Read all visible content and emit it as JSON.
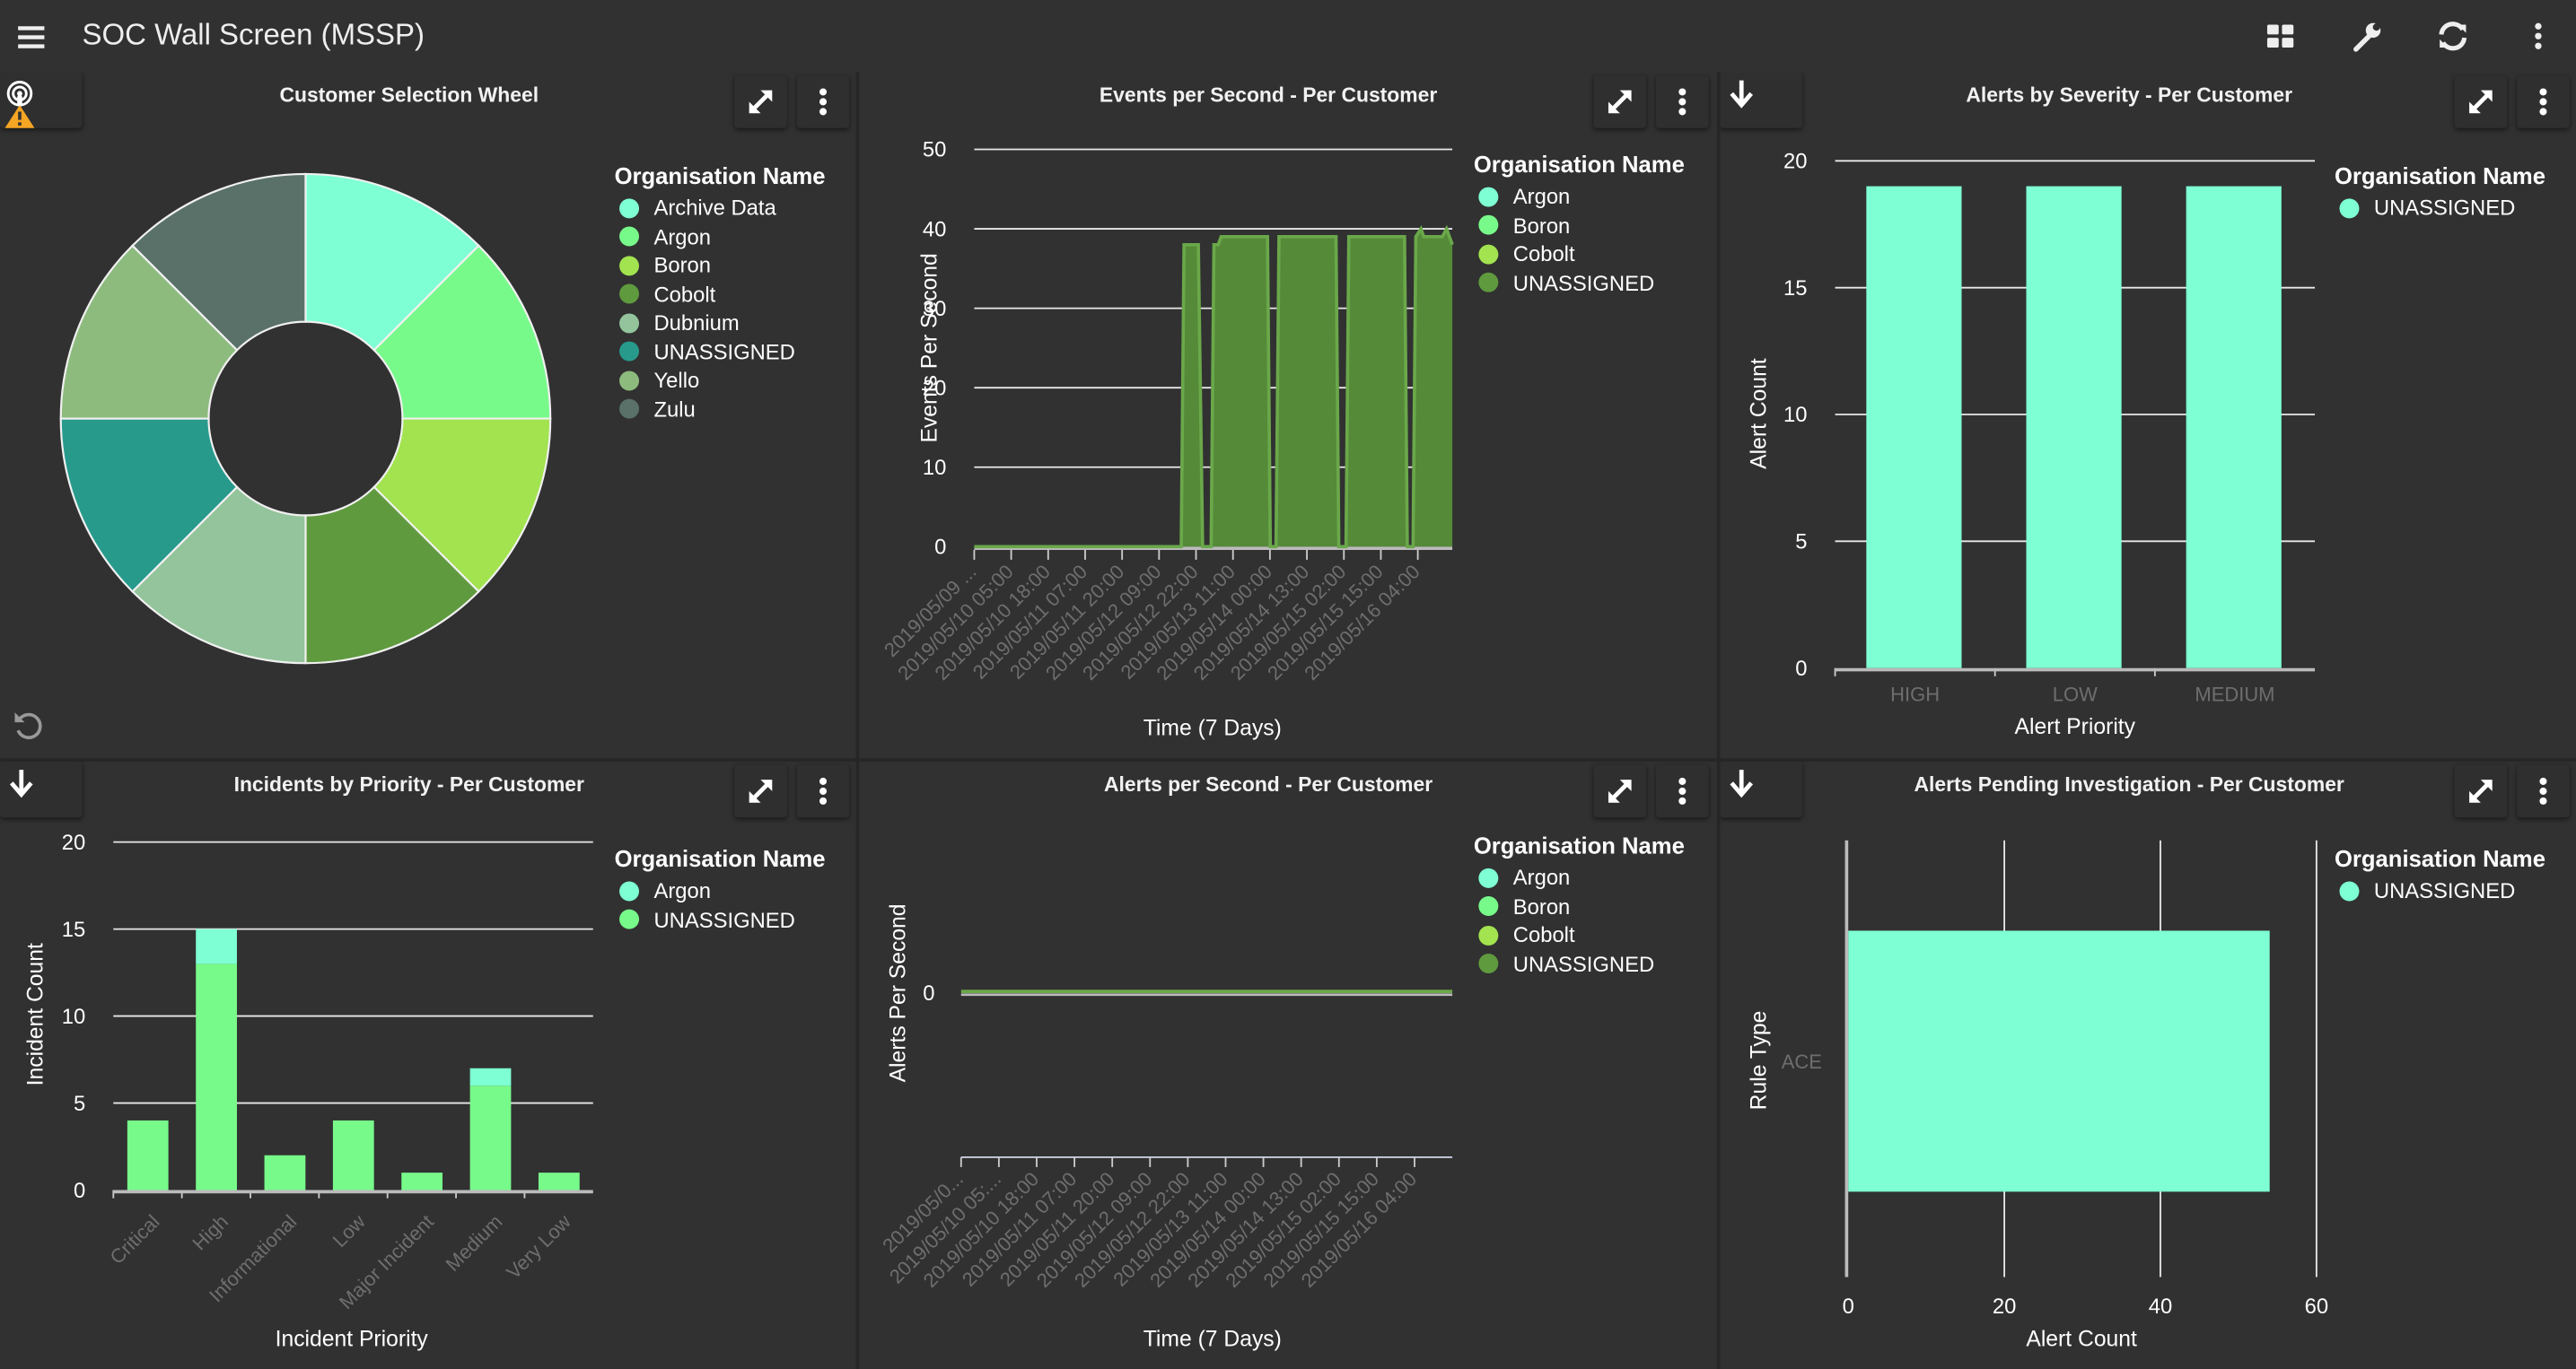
{
  "header": {
    "title": "SOC Wall Screen (MSSP)",
    "icons": [
      "menu-icon",
      "dashboard-grid-icon",
      "wrench-icon",
      "refresh-icon",
      "more-vertical-icon"
    ]
  },
  "colors": {
    "background": "#313131",
    "aquamarine": "#7effd4",
    "green": "#78fa8a",
    "lime": "#a2e34f",
    "darkgreen": "#5f9a3e",
    "warning": "#f5a623"
  },
  "panels": [
    {
      "title": "Customer Selection Wheel",
      "legend": {
        "title": "Organisation Name",
        "items": [
          {
            "label": "Archive Data",
            "color": "#7effd4"
          },
          {
            "label": "Argon",
            "color": "#78fa8a"
          },
          {
            "label": "Boron",
            "color": "#a2e34f"
          },
          {
            "label": "Cobolt",
            "color": "#5f9a3e"
          },
          {
            "label": "Dubnium",
            "color": "#93c49b"
          },
          {
            "label": "UNASSIGNED",
            "color": "#279a8c"
          },
          {
            "label": "Yello",
            "color": "#8dbb7e"
          },
          {
            "label": "Zulu",
            "color": "#5a716a"
          }
        ]
      }
    },
    {
      "title": "Events per Second - Per Customer",
      "legend": {
        "title": "Organisation Name",
        "items": [
          {
            "label": "Argon",
            "color": "#7effd4"
          },
          {
            "label": "Boron",
            "color": "#78fa8a"
          },
          {
            "label": "Cobolt",
            "color": "#a2e34f"
          },
          {
            "label": "UNASSIGNED",
            "color": "#5f9a3e"
          }
        ]
      }
    },
    {
      "title": "Alerts by Severity - Per Customer",
      "legend": {
        "title": "Organisation Name",
        "items": [
          {
            "label": "UNASSIGNED",
            "color": "#7effd4"
          }
        ]
      }
    },
    {
      "title": "Incidents by Priority - Per Customer",
      "legend": {
        "title": "Organisation Name",
        "items": [
          {
            "label": "Argon",
            "color": "#7effd4"
          },
          {
            "label": "UNASSIGNED",
            "color": "#78fa8a"
          }
        ]
      }
    },
    {
      "title": "Alerts per Second - Per Customer",
      "legend": {
        "title": "Organisation Name",
        "items": [
          {
            "label": "Argon",
            "color": "#7effd4"
          },
          {
            "label": "Boron",
            "color": "#78fa8a"
          },
          {
            "label": "Cobolt",
            "color": "#a2e34f"
          },
          {
            "label": "UNASSIGNED",
            "color": "#5f9a3e"
          }
        ]
      }
    },
    {
      "title": "Alerts Pending Investigation - Per Customer",
      "legend": {
        "title": "Organisation Name",
        "items": [
          {
            "label": "UNASSIGNED",
            "color": "#7effd4"
          }
        ]
      }
    }
  ],
  "chart_data": [
    {
      "type": "pie",
      "donut": true,
      "categories": [
        "Archive Data",
        "Argon",
        "Boron",
        "Cobolt",
        "Dubnium",
        "UNASSIGNED",
        "Yello",
        "Zulu"
      ],
      "values": [
        1,
        1,
        1,
        1,
        1,
        1,
        1,
        1
      ]
    },
    {
      "type": "area",
      "xlabel": "Time (7 Days)",
      "ylabel": "Events Per Second",
      "ylim": [
        0,
        50
      ],
      "yticks": [
        0,
        10,
        20,
        30,
        40,
        50
      ],
      "xtick_labels": [
        "2019/05/09 ...",
        "2019/05/10 05:00",
        "2019/05/10 18:00",
        "2019/05/11 07:00",
        "2019/05/11 20:00",
        "2019/05/12 09:00",
        "2019/05/12 22:00",
        "2019/05/13 11:00",
        "2019/05/14 00:00",
        "2019/05/14 13:00",
        "2019/05/15 02:00",
        "2019/05/15 15:00",
        "2019/05/16 04:00"
      ],
      "xlim": [
        "2019-05-09 16:00",
        "2019-05-16 15:30"
      ],
      "grid": true,
      "series": [
        {
          "name": "UNASSIGNED",
          "color": "#5f9a3e",
          "points": [
            [
              "2019-05-09 16:00",
              0
            ],
            [
              "2019-05-12 16:30",
              0
            ],
            [
              "2019-05-12 17:30",
              38
            ],
            [
              "2019-05-12 22:30",
              38
            ],
            [
              "2019-05-13 00:00",
              0
            ],
            [
              "2019-05-13 03:00",
              0
            ],
            [
              "2019-05-13 04:00",
              38
            ],
            [
              "2019-05-13 05:30",
              38
            ],
            [
              "2019-05-13 06:30",
              39
            ],
            [
              "2019-05-13 22:45",
              39
            ],
            [
              "2019-05-13 23:45",
              0
            ],
            [
              "2019-05-14 01:45",
              0
            ],
            [
              "2019-05-14 02:45",
              39
            ],
            [
              "2019-05-14 22:45",
              39
            ],
            [
              "2019-05-14 23:45",
              0
            ],
            [
              "2019-05-15 02:15",
              0
            ],
            [
              "2019-05-15 03:15",
              39
            ],
            [
              "2019-05-15 22:45",
              39
            ],
            [
              "2019-05-15 23:45",
              0
            ],
            [
              "2019-05-16 01:45",
              0
            ],
            [
              "2019-05-16 02:45",
              39
            ],
            [
              "2019-05-16 04:30",
              40
            ],
            [
              "2019-05-16 05:30",
              39
            ],
            [
              "2019-05-16 12:00",
              39
            ],
            [
              "2019-05-16 13:30",
              40
            ],
            [
              "2019-05-16 15:30",
              38
            ]
          ]
        }
      ]
    },
    {
      "type": "bar",
      "xlabel": "Alert Priority",
      "ylabel": "Alert Count",
      "ylim": [
        0,
        20
      ],
      "yticks": [
        0,
        5,
        10,
        15,
        20
      ],
      "grid": true,
      "categories": [
        "HIGH",
        "LOW",
        "MEDIUM"
      ],
      "series": [
        {
          "name": "UNASSIGNED",
          "color": "#7effd4",
          "values": [
            19,
            19,
            19
          ]
        }
      ]
    },
    {
      "type": "bar",
      "stacked": true,
      "xlabel": "Incident Priority",
      "ylabel": "Incident Count",
      "ylim": [
        0,
        20
      ],
      "yticks": [
        0,
        5,
        10,
        15,
        20
      ],
      "grid": true,
      "categories": [
        "Critical",
        "High",
        "Informational",
        "Low",
        "Major Incident",
        "Medium",
        "Very Low"
      ],
      "series": [
        {
          "name": "UNASSIGNED",
          "color": "#78fa8a",
          "values": [
            4,
            13,
            2,
            4,
            1,
            6,
            1
          ]
        },
        {
          "name": "Argon",
          "color": "#7effd4",
          "values": [
            0,
            2,
            0,
            0,
            0,
            1,
            0
          ]
        }
      ]
    },
    {
      "type": "line",
      "xlabel": "Time (7 Days)",
      "ylabel": "Alerts Per Second",
      "yticks": [
        0
      ],
      "xtick_labels": [
        "2019/05/0...",
        "2019/05/10 05:...",
        "2019/05/10 18:00",
        "2019/05/11 07:00",
        "2019/05/11 20:00",
        "2019/05/12 09:00",
        "2019/05/12 22:00",
        "2019/05/13 11:00",
        "2019/05/14 00:00",
        "2019/05/14 13:00",
        "2019/05/15 02:00",
        "2019/05/15 15:00",
        "2019/05/16 04:00"
      ],
      "series": [
        {
          "name": "UNASSIGNED",
          "color": "#5f9a3e",
          "values": [
            0,
            0,
            0,
            0,
            0,
            0,
            0,
            0,
            0,
            0,
            0,
            0,
            0,
            0
          ]
        }
      ]
    },
    {
      "type": "bar",
      "orientation": "horizontal",
      "xlabel": "Alert Count",
      "ylabel": "Rule Type",
      "xlim": [
        0,
        60
      ],
      "xticks": [
        0,
        20,
        40,
        60
      ],
      "grid": true,
      "categories": [
        "ACE"
      ],
      "series": [
        {
          "name": "UNASSIGNED",
          "color": "#7effd4",
          "values": [
            54
          ]
        }
      ]
    }
  ]
}
